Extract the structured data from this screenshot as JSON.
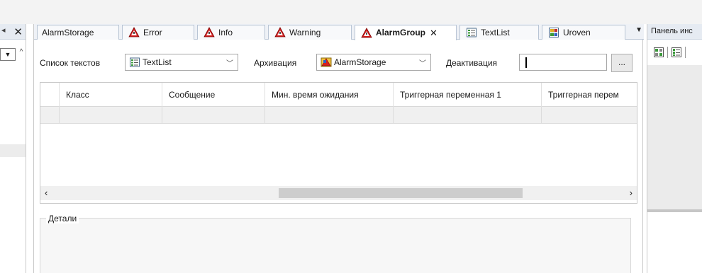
{
  "tabs": [
    {
      "label": "AlarmStorage",
      "icon": "none"
    },
    {
      "label": "Error",
      "icon": "alarm-class-icon"
    },
    {
      "label": "Info",
      "icon": "alarm-class-icon"
    },
    {
      "label": "Warning",
      "icon": "alarm-class-icon"
    },
    {
      "label": "AlarmGroup",
      "icon": "alarm-class-icon",
      "active": true
    },
    {
      "label": "TextList",
      "icon": "textlist-icon"
    },
    {
      "label": "Uroven",
      "icon": "visualization-icon"
    }
  ],
  "toolbar": {
    "textlist_label": "Список текстов",
    "textlist_value": "TextList",
    "archive_label": "Архивация",
    "archive_value": "AlarmStorage",
    "deactivation_label": "Деактивация",
    "deactivation_value": "",
    "ellipsis_label": "..."
  },
  "grid": {
    "columns": [
      "Класс",
      "Сообщение",
      "Мин. время ожидания",
      "Триггерная переменная 1",
      "Триггерная перем"
    ]
  },
  "details": {
    "legend": "Детали"
  },
  "right_panel": {
    "title": "Панель инс"
  },
  "colors": {
    "tab_bar": "#eef1f6",
    "alarm_red": "#d42020",
    "panel_gray": "#ebebeb"
  }
}
